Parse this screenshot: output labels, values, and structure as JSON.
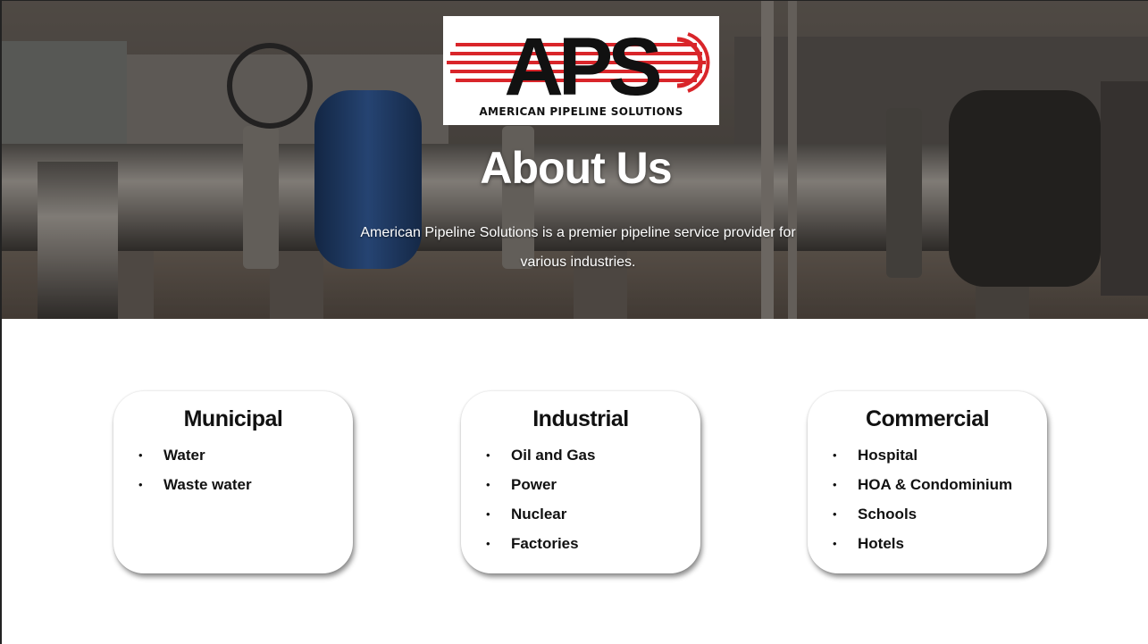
{
  "logo": {
    "mark_text": "APS",
    "subtitle": "AMERICAN PIPELINE SOLUTIONS",
    "colors": {
      "mark": "#111111",
      "stripes": "#d9252a"
    }
  },
  "hero": {
    "title": "About Us",
    "description": "American Pipeline Solutions is a premier pipeline service provider for various industries."
  },
  "cards": [
    {
      "title": "Municipal",
      "items": [
        "Water",
        "Waste water"
      ]
    },
    {
      "title": "Industrial",
      "items": [
        "Oil and Gas",
        "Power",
        "Nuclear",
        "Factories"
      ]
    },
    {
      "title": "Commercial",
      "items": [
        "Hospital",
        "HOA & Condominium",
        "Schools",
        "Hotels"
      ]
    }
  ],
  "bullet_glyph": "•"
}
